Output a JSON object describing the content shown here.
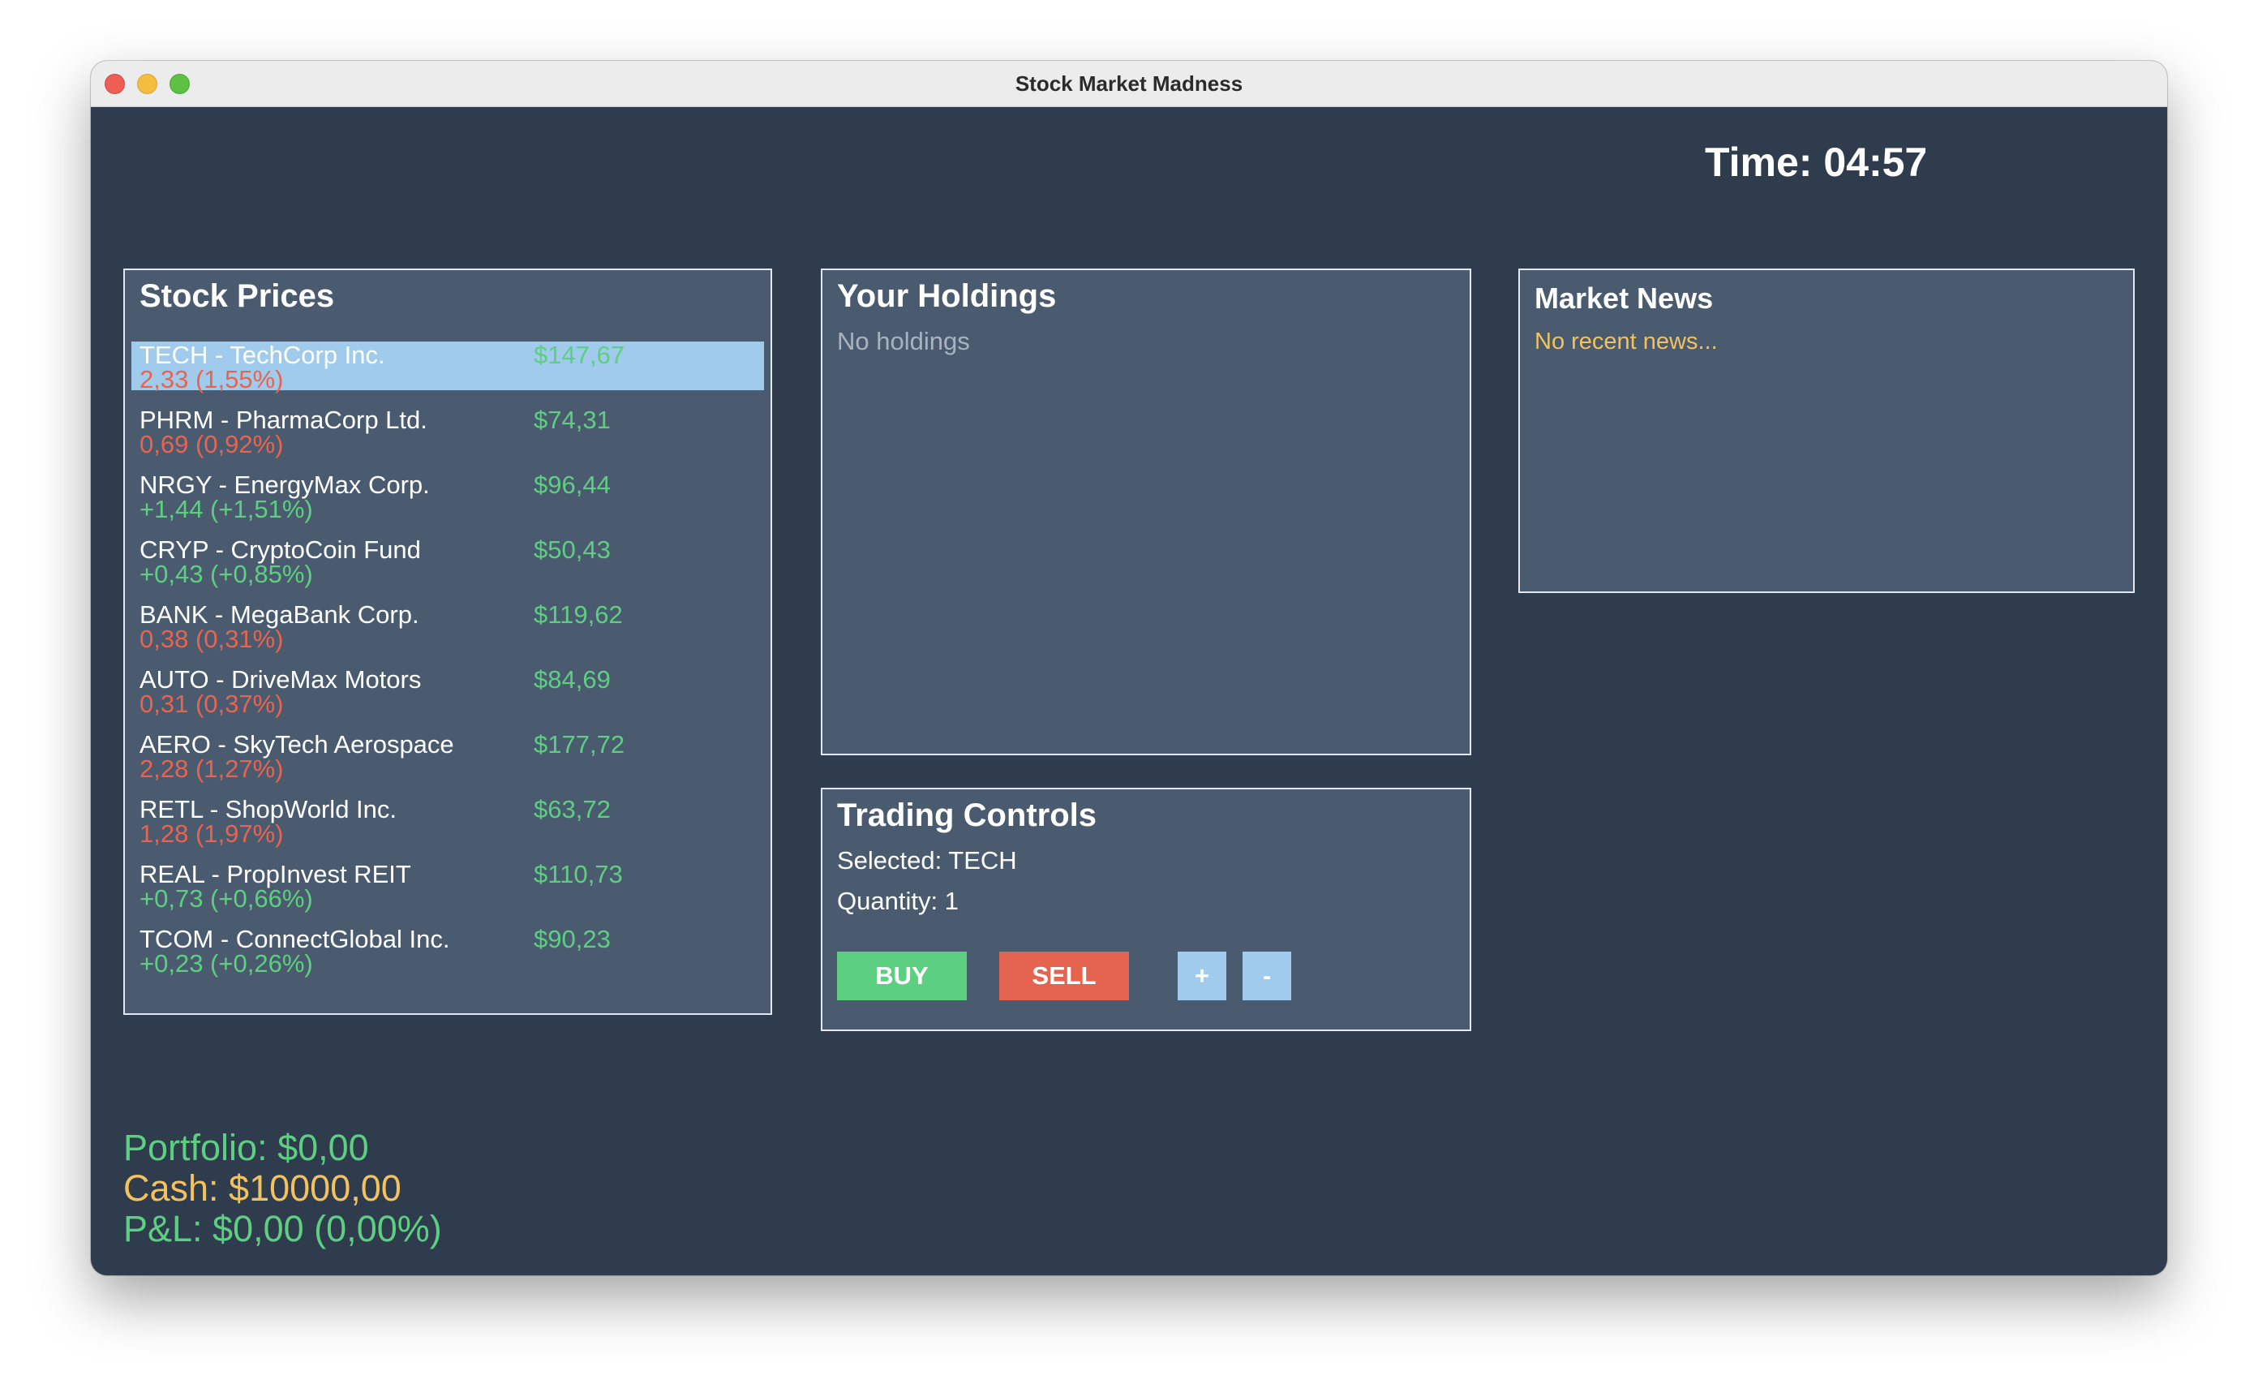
{
  "window": {
    "title": "Stock Market Madness"
  },
  "header": {
    "timer": "Time: 04:57"
  },
  "stock_prices": {
    "title": "Stock Prices",
    "selected_index": 0,
    "stocks": [
      {
        "name": "TECH - TechCorp Inc.",
        "price": "$147,67",
        "change": "2,33 (1,55%)",
        "direction": "down"
      },
      {
        "name": "PHRM - PharmaCorp Ltd.",
        "price": "$74,31",
        "change": "0,69 (0,92%)",
        "direction": "down"
      },
      {
        "name": "NRGY - EnergyMax Corp.",
        "price": "$96,44",
        "change": "+1,44 (+1,51%)",
        "direction": "up"
      },
      {
        "name": "CRYP - CryptoCoin Fund",
        "price": "$50,43",
        "change": "+0,43 (+0,85%)",
        "direction": "up"
      },
      {
        "name": "BANK - MegaBank Corp.",
        "price": "$119,62",
        "change": "0,38 (0,31%)",
        "direction": "down"
      },
      {
        "name": "AUTO - DriveMax Motors",
        "price": "$84,69",
        "change": "0,31 (0,37%)",
        "direction": "down"
      },
      {
        "name": "AERO - SkyTech Aerospace",
        "price": "$177,72",
        "change": "2,28 (1,27%)",
        "direction": "down"
      },
      {
        "name": "RETL - ShopWorld Inc.",
        "price": "$63,72",
        "change": "1,28 (1,97%)",
        "direction": "down"
      },
      {
        "name": "REAL - PropInvest REIT",
        "price": "$110,73",
        "change": "+0,73 (+0,66%)",
        "direction": "up"
      },
      {
        "name": "TCOM - ConnectGlobal Inc.",
        "price": "$90,23",
        "change": "+0,23 (+0,26%)",
        "direction": "up"
      }
    ]
  },
  "holdings": {
    "title": "Your Holdings",
    "empty_text": "No holdings"
  },
  "news": {
    "title": "Market News",
    "empty_text": "No recent news..."
  },
  "trading": {
    "title": "Trading Controls",
    "selected": "Selected: TECH",
    "quantity": "Quantity: 1",
    "buy_label": "BUY",
    "sell_label": "SELL",
    "plus_label": "+",
    "minus_label": "-"
  },
  "summary": {
    "portfolio": "Portfolio: $0,00",
    "cash": "Cash: $10000,00",
    "pl": "P&L: $0,00 (0,00%)"
  },
  "colors": {
    "background": "#2f3c4e",
    "panel": "#4a5b70",
    "positive": "#5dcf80",
    "negative": "#e8644f",
    "cash": "#f3c25e",
    "selected_row": "#a0cbec"
  }
}
